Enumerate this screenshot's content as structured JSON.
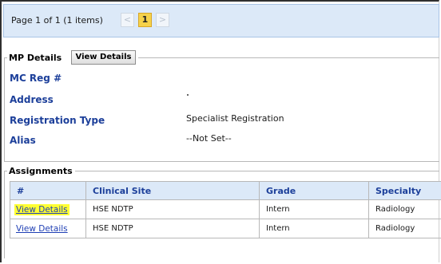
{
  "pager": {
    "summary": "Page 1 of 1 (1 items)",
    "prev_symbol": "<",
    "current_page": "1",
    "next_symbol": ">"
  },
  "mp_details": {
    "legend": "MP Details",
    "view_details_button": "View Details",
    "fields": [
      {
        "label": "MC Reg #",
        "value": ""
      },
      {
        "label": "Address",
        "value": ""
      },
      {
        "label": "Registration Type",
        "value": "Specialist Registration"
      },
      {
        "label": "Alias",
        "value": "--Not Set--"
      }
    ]
  },
  "assignments": {
    "legend": "Assignments",
    "columns": [
      "#",
      "Clinical Site",
      "Grade",
      "Specialty"
    ],
    "rows": [
      {
        "link": "View Details",
        "site": "HSE NDTP",
        "grade": "Intern",
        "specialty": "Radiology",
        "highlighted": true
      },
      {
        "link": "View Details",
        "site": "HSE NDTP",
        "grade": "Intern",
        "specialty": "Radiology",
        "highlighted": false
      }
    ]
  },
  "colors": {
    "header_bg": "#dce9f8",
    "label_blue": "#1c3f9a",
    "link_blue": "#1f3fb4",
    "highlight": "#ffff33",
    "current_page_bg": "#f6d24a"
  }
}
